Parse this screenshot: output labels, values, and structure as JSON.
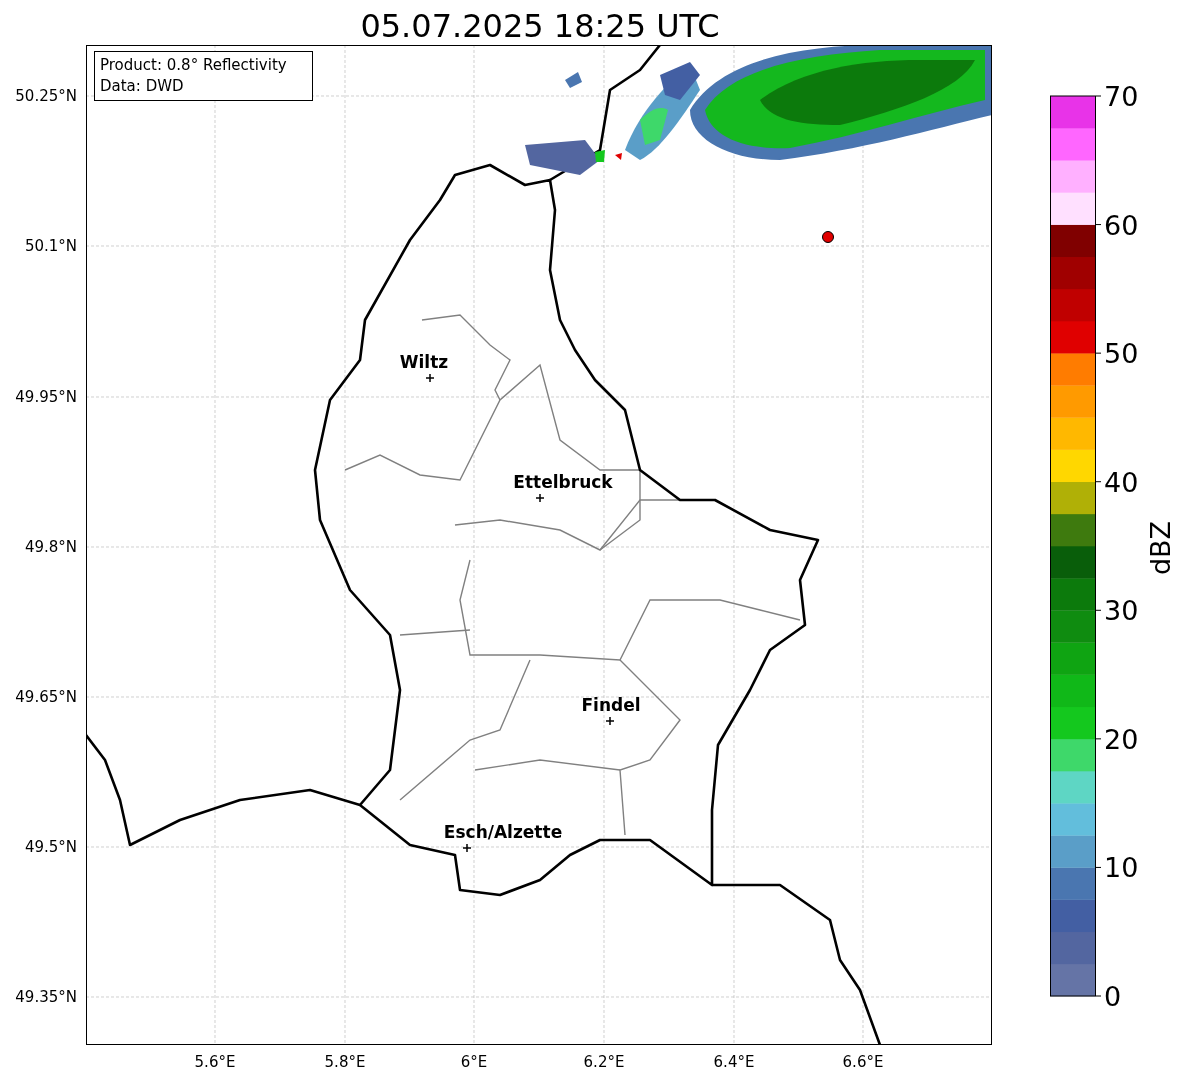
{
  "title": "05.07.2025 18:25 UTC",
  "info_box": {
    "lines": [
      "Product: 0.8° Reflectivity",
      "Data: DWD"
    ]
  },
  "map": {
    "y_ticks": [
      "50.25°N",
      "50.1°N",
      "49.95°N",
      "49.8°N",
      "49.65°N",
      "49.5°N",
      "49.35°N"
    ],
    "x_ticks": [
      "5.6°E",
      "5.8°E",
      "6°E",
      "6.2°E",
      "6.4°E",
      "6.6°E"
    ],
    "cities": [
      {
        "name": "Wiltz"
      },
      {
        "name": "Ettelbruck"
      },
      {
        "name": "Findel"
      },
      {
        "name": "Esch/Alzette"
      }
    ]
  },
  "colorbar": {
    "label": "dBZ",
    "ticks": [
      "70",
      "60",
      "50",
      "40",
      "30",
      "20",
      "10",
      "0"
    ],
    "segments": [
      {
        "color": "#6574a6"
      },
      {
        "color": "#5366a0"
      },
      {
        "color": "#435fa3"
      },
      {
        "color": "#4a76b0"
      },
      {
        "color": "#5a9ec8"
      },
      {
        "color": "#62bedc"
      },
      {
        "color": "#5ed6c4"
      },
      {
        "color": "#3ed86a"
      },
      {
        "color": "#14c81e"
      },
      {
        "color": "#10b818"
      },
      {
        "color": "#0fa412"
      },
      {
        "color": "#0f8c10"
      },
      {
        "color": "#0c7a0c"
      },
      {
        "color": "#095e0a"
      },
      {
        "color": "#3e7a0e"
      },
      {
        "color": "#b0b006"
      },
      {
        "color": "#ffd700"
      },
      {
        "color": "#ffb800"
      },
      {
        "color": "#ff9a00"
      },
      {
        "color": "#ff7c00"
      },
      {
        "color": "#e00000"
      },
      {
        "color": "#c00000"
      },
      {
        "color": "#a00000"
      },
      {
        "color": "#800000"
      },
      {
        "color": "#ffe0ff"
      },
      {
        "color": "#ffb0ff"
      },
      {
        "color": "#ff66ff"
      },
      {
        "color": "#e833e8"
      }
    ]
  }
}
